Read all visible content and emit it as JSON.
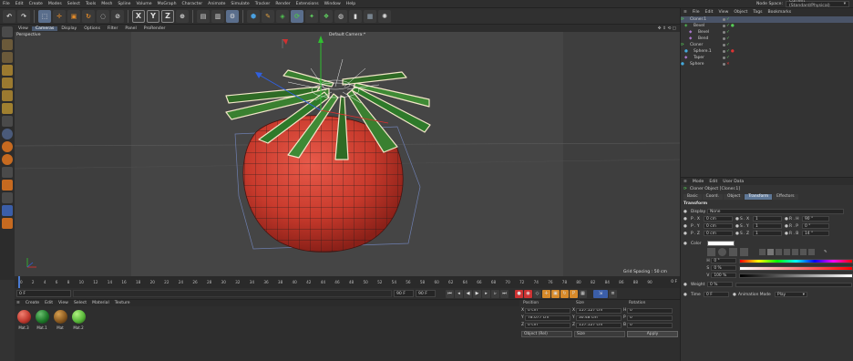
{
  "menubar": {
    "items": [
      "File",
      "Edit",
      "Create",
      "Modes",
      "Select",
      "Tools",
      "Mesh",
      "Spline",
      "Volume",
      "MoGraph",
      "Character",
      "Animate",
      "Simulate",
      "Tracker",
      "Render",
      "Extensions",
      "Window",
      "Help"
    ],
    "node_space_label": "Node Space:",
    "node_space_value": "Current (Standard/Physical)"
  },
  "toolbar": {
    "axis_x": "X",
    "axis_y": "Y",
    "axis_z": "Z"
  },
  "view_menu": {
    "items": [
      "View",
      "Cameras",
      "Display",
      "Options",
      "Filter",
      "Panel",
      "ProRender"
    ],
    "active": "Cameras"
  },
  "viewport": {
    "label": "Perspective",
    "camera": "Default Camera:*",
    "grid_spacing": "Grid Spacing : 50 cm"
  },
  "timeline": {
    "ticks": [
      "0",
      "2",
      "4",
      "6",
      "8",
      "10",
      "12",
      "14",
      "16",
      "18",
      "20",
      "22",
      "24",
      "26",
      "28",
      "30",
      "32",
      "34",
      "36",
      "38",
      "40",
      "42",
      "44",
      "46",
      "48",
      "50",
      "52",
      "54",
      "56",
      "58",
      "60",
      "62",
      "64",
      "66",
      "68",
      "70",
      "72",
      "74",
      "76",
      "78",
      "80",
      "82",
      "84",
      "86",
      "88",
      "90"
    ],
    "end_label": "0 F"
  },
  "transport": {
    "current": "0 F",
    "start": "0 F",
    "end": "90 F",
    "end2": "90 F"
  },
  "material_manager": {
    "menu": [
      "Create",
      "Edit",
      "View",
      "Select",
      "Material",
      "Texture"
    ],
    "materials": [
      {
        "name": "Mat.3",
        "color": "#c23b30"
      },
      {
        "name": "Mat.1",
        "color": "#1f7a2a"
      },
      {
        "name": "Mat",
        "color": "#8a5a20"
      },
      {
        "name": "Mat.2",
        "color": "#59b83a"
      }
    ]
  },
  "coordinates": {
    "headers": [
      "Position",
      "Size",
      "Rotation"
    ],
    "rows": [
      {
        "axis": "X",
        "pos": "0 cm",
        "size_axis": "X",
        "size": "157.127 cm",
        "rot_axis": "H",
        "rot": "0 °"
      },
      {
        "axis": "Y",
        "pos": "78.077 cm",
        "size_axis": "Y",
        "size": "30.48 cm",
        "rot_axis": "P",
        "rot": "0 °"
      },
      {
        "axis": "Z",
        "pos": "0 cm",
        "size_axis": "Z",
        "size": "157.127 cm",
        "rot_axis": "B",
        "rot": "0 °"
      }
    ],
    "mode_dropdown": "Object (Rel)",
    "size_dropdown": "Size",
    "apply_label": "Apply"
  },
  "object_manager": {
    "menu": [
      "File",
      "Edit",
      "View",
      "Object",
      "Tags",
      "Bookmarks"
    ],
    "objects": [
      {
        "name": "Cloner.1",
        "indent": 0,
        "selected": true
      },
      {
        "name": "Bevel",
        "indent": 1,
        "selected": false
      },
      {
        "name": "Bevel",
        "indent": 2,
        "selected": false
      },
      {
        "name": "Bend",
        "indent": 2,
        "selected": false
      },
      {
        "name": "Cloner",
        "indent": 0,
        "selected": false
      },
      {
        "name": "Sphere.1",
        "indent": 1,
        "selected": false
      },
      {
        "name": "Taper",
        "indent": 1,
        "selected": false
      },
      {
        "name": "Sphere",
        "indent": 0,
        "selected": false
      }
    ]
  },
  "attribute_manager": {
    "menu": [
      "Mode",
      "Edit",
      "User Data"
    ],
    "title": "Cloner Object [Cloner.1]",
    "tabs": [
      "Basic",
      "Coord.",
      "Object",
      "Transform",
      "Effectors"
    ],
    "active_tab": "Transform",
    "section": "Transform",
    "display_label": "Display",
    "display_value": "None",
    "pos": [
      {
        "p_label": "P . X",
        "p_val": "0 cm",
        "s_label": "S . X",
        "s_val": "1",
        "r_label": "R . H",
        "r_val": "90 °"
      },
      {
        "p_label": "P . Y",
        "p_val": "0 cm",
        "s_label": "S . Y",
        "s_val": "1",
        "r_label": "R . P",
        "r_val": "0 °"
      },
      {
        "p_label": "P . Z",
        "p_val": "0 cm",
        "s_label": "S . Z",
        "s_val": "1",
        "r_label": "R . B",
        "r_val": "14 °"
      }
    ],
    "color_label": "Color",
    "h_label": "H",
    "h_val": "0 °",
    "s_label": "S",
    "s_val": "0 %",
    "v_label": "V",
    "v_val": "100 %",
    "weight_label": "Weight",
    "weight_val": "0 %",
    "time_label": "Time",
    "time_val": "0 F",
    "anim_mode_label": "Animation Mode",
    "anim_mode_val": "Play"
  }
}
